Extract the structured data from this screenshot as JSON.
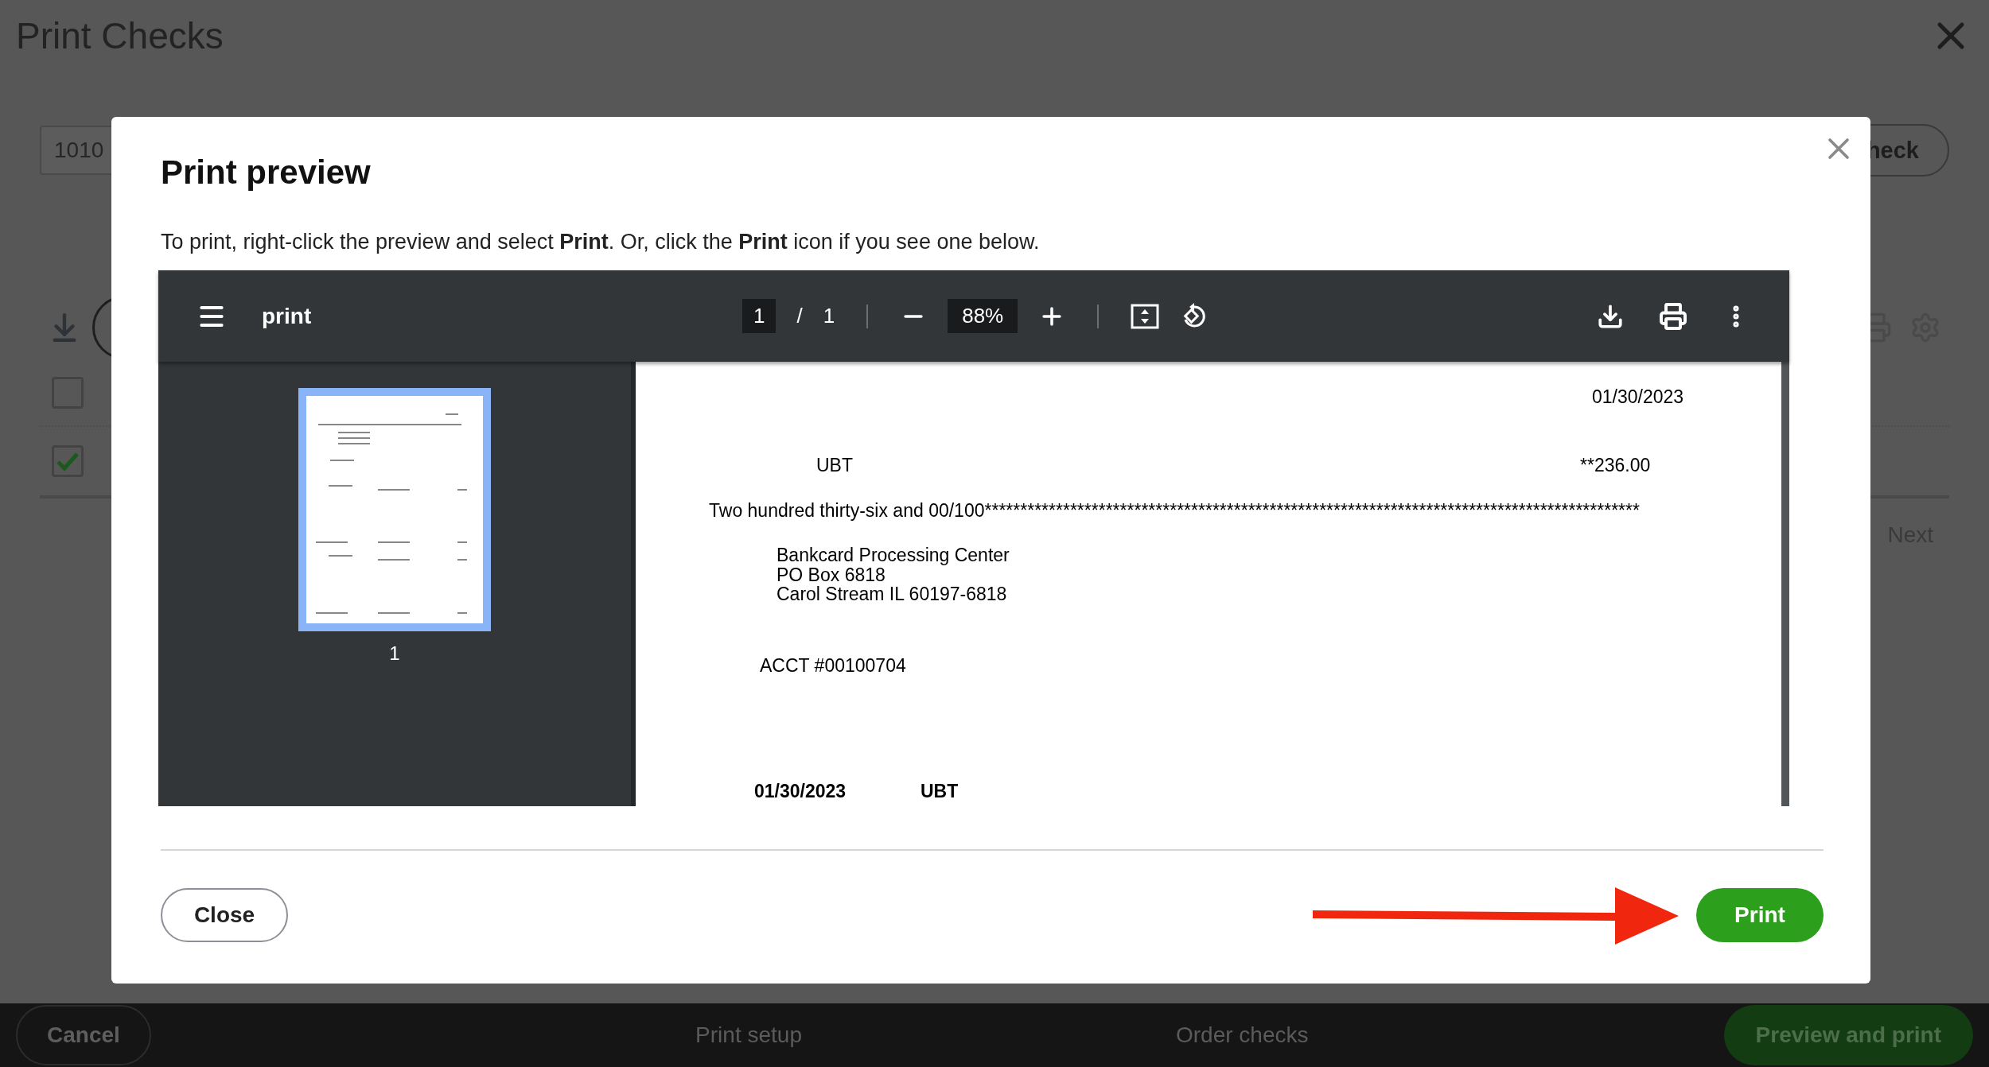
{
  "page": {
    "title": "Print Checks",
    "account_field": {
      "value": "1010"
    },
    "add_check_button": "heck",
    "rows": [
      {
        "checked": false
      },
      {
        "checked": true
      }
    ],
    "next_link": "Next"
  },
  "dialog": {
    "title": "Print preview",
    "instructions": "To print, right-click the preview and select **Print**. Or, click the **Print** icon if you see one below.",
    "viewer": {
      "file_name": "print",
      "page": "1",
      "page_separator": "/",
      "page_count": "1",
      "zoom": "88%",
      "thumbnail_label": "1",
      "document": {
        "date": "01/30/2023",
        "payee": "UBT",
        "amount": "**236.00",
        "amount_words": "Two hundred thirty-six and 00/100********************************************************************************************",
        "address": [
          "Bankcard Processing Center",
          "PO Box 6818",
          "Carol Stream IL 60197-6818"
        ],
        "account": "ACCT #00100704",
        "stub": [
          "01/30/2023",
          "UBT"
        ]
      }
    },
    "buttons": {
      "close": "Close",
      "print": "Print"
    }
  },
  "footer": {
    "cancel": "Cancel",
    "links": [
      "Print setup",
      "Order checks"
    ],
    "primary": "Preview and print"
  }
}
